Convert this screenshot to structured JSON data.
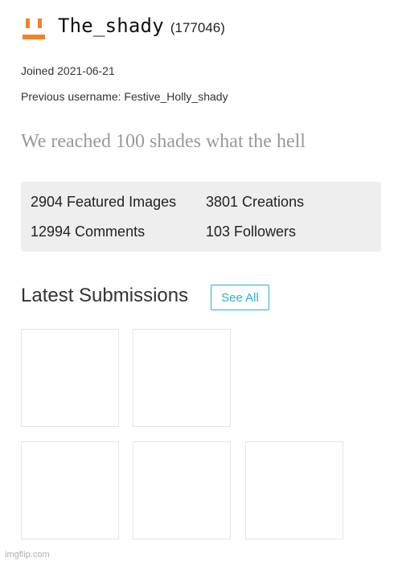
{
  "profile": {
    "username": "The_shady",
    "points": "(177046)",
    "joined": "Joined 2021-06-21",
    "previous_username": "Previous username: Festive_Holly_shady",
    "bio": "We reached 100 shades what the hell",
    "icon": "orange-face-icon",
    "accent_color": "#f5802a"
  },
  "stats": {
    "featured_images": "2904 Featured Images",
    "creations": "3801 Creations",
    "comments": "12994 Comments",
    "followers": "103 Followers"
  },
  "submissions": {
    "title": "Latest Submissions",
    "see_all_label": "See All",
    "link_color": "#2bb0c8"
  },
  "watermark": "imgflip.com"
}
